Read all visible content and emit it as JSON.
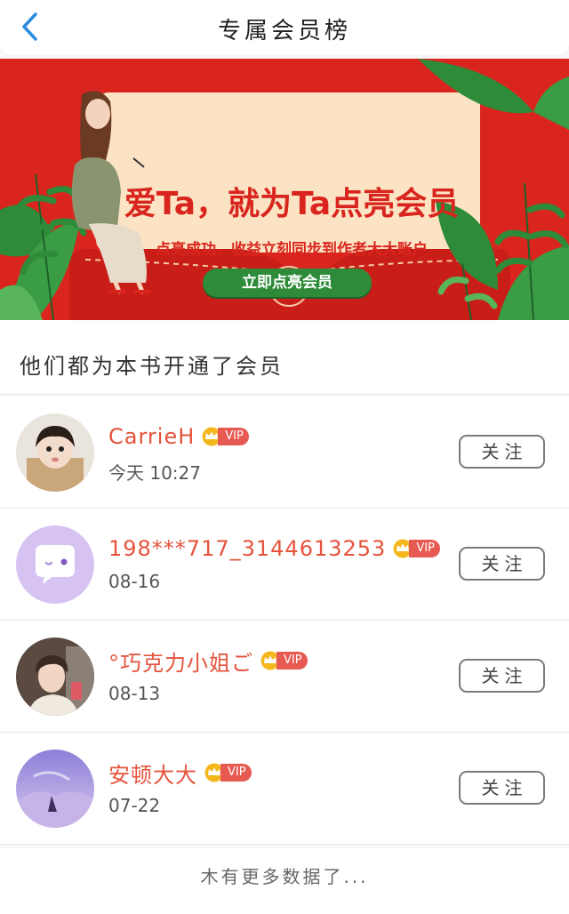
{
  "header": {
    "title": "专属会员榜"
  },
  "banner": {
    "headline": "爱Ta，就为Ta点亮会员",
    "subline": "点亮成功，收益立刻同步到作者大大账户",
    "button_label": "立即点亮会员",
    "colors": {
      "background": "#d9251d",
      "card": "#fbe3c4",
      "button": "#2e8b3a",
      "leaf": "#2e8b3a"
    }
  },
  "section": {
    "title": "他们都为本书开通了会员"
  },
  "members": [
    {
      "name": "CarrieH",
      "vip": "VIP",
      "time": "今天 10:27",
      "follow": "关注",
      "avatar": "child-photo"
    },
    {
      "name": "198***717_3144613253",
      "vip": "VIP",
      "time": "08-16",
      "follow": "关注",
      "avatar": "default-chat-bubble"
    },
    {
      "name": "°巧克力小姐ご",
      "vip": "VIP",
      "time": "08-13",
      "follow": "关注",
      "avatar": "man-photo"
    },
    {
      "name": "安顿大大",
      "vip": "VIP",
      "time": "07-22",
      "follow": "关注",
      "avatar": "purple-sky-photo"
    }
  ],
  "footer": {
    "text": "木有更多数据了..."
  },
  "colors": {
    "name": "#e5533c",
    "vip_tag": "#e65a52",
    "back_arrow": "#2b8cde"
  }
}
